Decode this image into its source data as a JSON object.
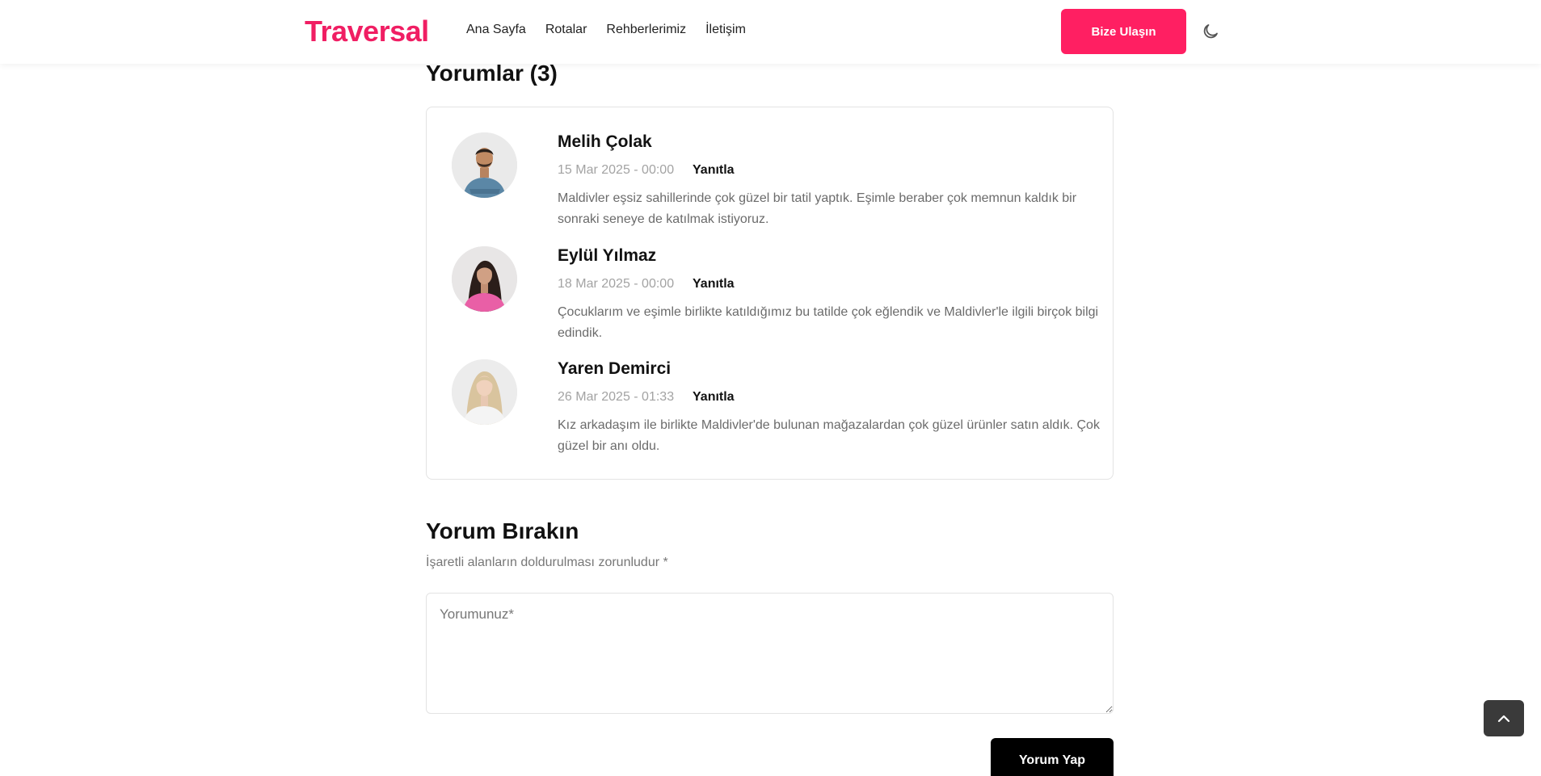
{
  "header": {
    "logo": "Traversal",
    "nav": [
      "Ana Sayfa",
      "Rotalar",
      "Rehberlerimiz",
      "İletişim"
    ],
    "cta_label": "Bize Ulaşın",
    "theme_icon": "moon-icon"
  },
  "comments": {
    "title": "Yorumlar (3)",
    "reply_label": "Yanıtla",
    "items": [
      {
        "name": "Melih Çolak",
        "date": "15 Mar 2025 - 00:00",
        "text": "Maldivler eşsiz sahillerinde çok güzel bir tatil yaptık. Eşimle beraber çok memnun kaldık bir sonraki seneye de katılmak istiyoruz."
      },
      {
        "name": "Eylül Yılmaz",
        "date": "18 Mar 2025 - 00:00",
        "text": "Çocuklarım ve eşimle birlikte katıldığımız bu tatilde çok eğlendik ve Maldivler'le ilgili birçok bilgi edindik."
      },
      {
        "name": "Yaren Demirci",
        "date": "26 Mar 2025 - 01:33",
        "text": "Kız arkadaşım ile birlikte Maldivler'de bulunan mağazalardan çok güzel ürünler satın aldık. Çok güzel bir anı oldu."
      }
    ]
  },
  "form": {
    "title": "Yorum Bırakın",
    "note": "İşaretli alanların doldurulması zorunludur *",
    "placeholder": "Yorumunuz*",
    "submit_label": "Yorum Yap"
  },
  "colors": {
    "brand": "#f01e63",
    "cta": "#ff1f62",
    "submit": "#000000"
  }
}
